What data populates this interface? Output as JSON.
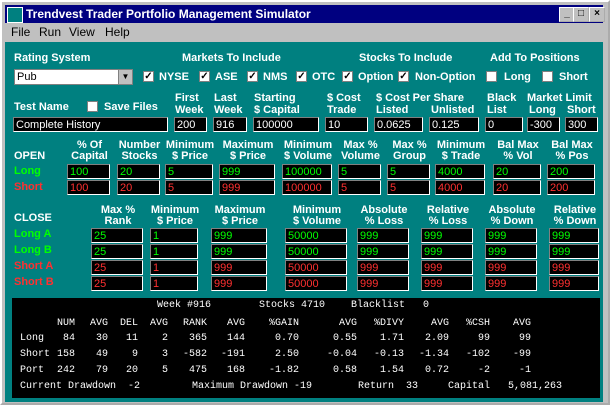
{
  "window": {
    "title": "Trendvest Trader Portfolio Management Simulator"
  },
  "menu": [
    "File",
    "Run",
    "View",
    "Help"
  ],
  "rating": {
    "label": "Rating System",
    "value": "Pub"
  },
  "markets": {
    "label": "Markets To Include",
    "items": [
      {
        "label": "NYSE",
        "checked": true
      },
      {
        "label": "ASE",
        "checked": true
      },
      {
        "label": "NMS",
        "checked": true
      },
      {
        "label": "OTC",
        "checked": true
      }
    ]
  },
  "stocks": {
    "label": "Stocks To Include",
    "items": [
      {
        "label": "Option",
        "checked": true
      },
      {
        "label": "Non-Option",
        "checked": true
      }
    ]
  },
  "add_positions": {
    "label": "Add To Positions",
    "items": [
      {
        "label": "Long",
        "checked": false
      },
      {
        "label": "Short",
        "checked": false
      }
    ]
  },
  "test": {
    "label": "Test Name",
    "value": "Complete History",
    "save_label": "Save Files",
    "save_checked": false
  },
  "params": {
    "first_week": {
      "label1": "First",
      "label2": "Week",
      "value": "200"
    },
    "last_week": {
      "label1": "Last",
      "label2": "Week",
      "value": "916"
    },
    "starting_capital": {
      "label1": "Starting",
      "label2": "$ Capital",
      "value": "100000"
    },
    "cost_trade": {
      "label1": "$ Cost",
      "label2": "Trade",
      "value": "10"
    },
    "cost_per_share_header": "$ Cost Per Share",
    "listed": {
      "label": "Listed",
      "value": "0.0625"
    },
    "unlisted": {
      "label": "Unlisted",
      "value": "0.125"
    },
    "black_list": {
      "label1": "Black",
      "label2": "List",
      "value": "0"
    },
    "market_limit_header": "Market Limit",
    "long": {
      "label": "Long",
      "value": "-300"
    },
    "short": {
      "label": "Short",
      "value": "300"
    }
  },
  "open": {
    "title": "OPEN",
    "headers": [
      [
        "% Of",
        "Capital"
      ],
      [
        "Number",
        "Stocks"
      ],
      [
        "Minimum",
        "$ Price"
      ],
      [
        "Maximum",
        "$ Price"
      ],
      [
        "Minimum",
        "$ Volume"
      ],
      [
        "Max %",
        "Volume"
      ],
      [
        "Max %",
        "Group"
      ],
      [
        "Minimum",
        "$ Trade"
      ],
      [
        "Bal Max",
        "% Vol"
      ],
      [
        "Bal Max",
        "% Pos"
      ]
    ],
    "rows": [
      {
        "label": "Long",
        "values": [
          "100",
          "20",
          "5",
          "999",
          "100000",
          "5",
          "5",
          "4000",
          "20",
          "200"
        ]
      },
      {
        "label": "Short",
        "values": [
          "100",
          "20",
          "5",
          "999",
          "100000",
          "5",
          "5",
          "4000",
          "20",
          "200"
        ]
      }
    ]
  },
  "close": {
    "title": "CLOSE",
    "headers": [
      [
        "Max %",
        "Rank"
      ],
      [
        "Minimum",
        "$ Price"
      ],
      [
        "Maximum",
        "$ Price"
      ],
      [
        "Minimum",
        "$ Volume"
      ],
      [
        "Absolute",
        "% Loss"
      ],
      [
        "Relative",
        "% Loss"
      ],
      [
        "Absolute",
        "% Down"
      ],
      [
        "Relative",
        "% Down"
      ]
    ],
    "rows": [
      {
        "label": "Long A",
        "values": [
          "25",
          "1",
          "999",
          "50000",
          "999",
          "999",
          "999",
          "999"
        ]
      },
      {
        "label": "Long B",
        "values": [
          "25",
          "1",
          "999",
          "50000",
          "999",
          "999",
          "999",
          "999"
        ]
      },
      {
        "label": "Short A",
        "values": [
          "25",
          "1",
          "999",
          "50000",
          "999",
          "999",
          "999",
          "999"
        ]
      },
      {
        "label": "Short B",
        "values": [
          "25",
          "1",
          "999",
          "50000",
          "999",
          "999",
          "999",
          "999"
        ]
      }
    ]
  },
  "stats": {
    "week": "Week #916",
    "stocks": "Stocks 4710",
    "blacklist": "Blacklist   0",
    "headers": [
      "NUM",
      "AVG",
      "DEL",
      "AVG",
      "RANK",
      "AVG",
      "%GAIN",
      "AVG",
      "%DIVY",
      "AVG",
      "%CSH",
      "AVG"
    ],
    "rows": [
      {
        "label": "Long",
        "values": [
          "84",
          "30",
          "11",
          "2",
          "365",
          "144",
          "0.70",
          "0.55",
          "1.71",
          "2.09",
          "99",
          "99"
        ]
      },
      {
        "label": "Short",
        "values": [
          "158",
          "49",
          "9",
          "3",
          "-582",
          "-191",
          "2.50",
          "-0.04",
          "-0.13",
          "-1.34",
          "-102",
          "-99"
        ]
      },
      {
        "label": "Port",
        "values": [
          "242",
          "79",
          "20",
          "5",
          "475",
          "168",
          "-1.82",
          "0.58",
          "1.54",
          "0.72",
          "-2",
          "-1"
        ]
      }
    ],
    "footer": {
      "current_drawdown": "Current Drawdown  -2",
      "maximum_drawdown": "Maximum Drawdown -19",
      "return": "Return  33",
      "capital": "Capital   5,081,263"
    }
  }
}
